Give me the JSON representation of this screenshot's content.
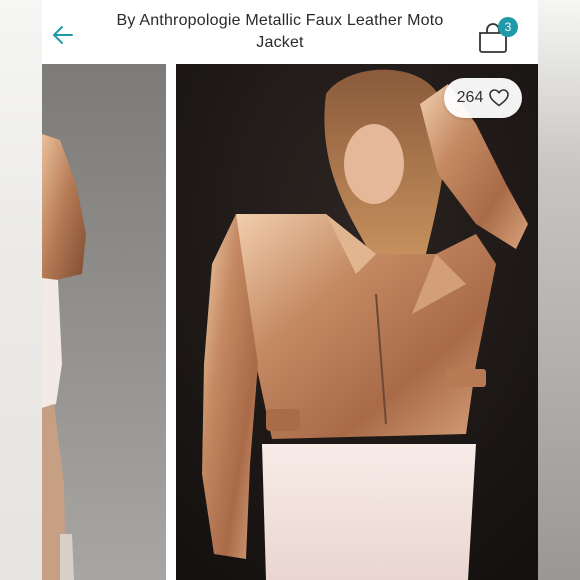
{
  "header": {
    "back_icon": "arrow-left-icon",
    "title": "By Anthropologie Metallic Faux Leather Moto Jacket",
    "bag_icon": "shopping-bag-icon",
    "bag_count": "3"
  },
  "gallery": {
    "like_count": "264",
    "like_icon": "heart-outline-icon"
  },
  "colors": {
    "accent": "#1f9aa8",
    "text": "#2a2a2a",
    "jacket": "#c9906c"
  }
}
